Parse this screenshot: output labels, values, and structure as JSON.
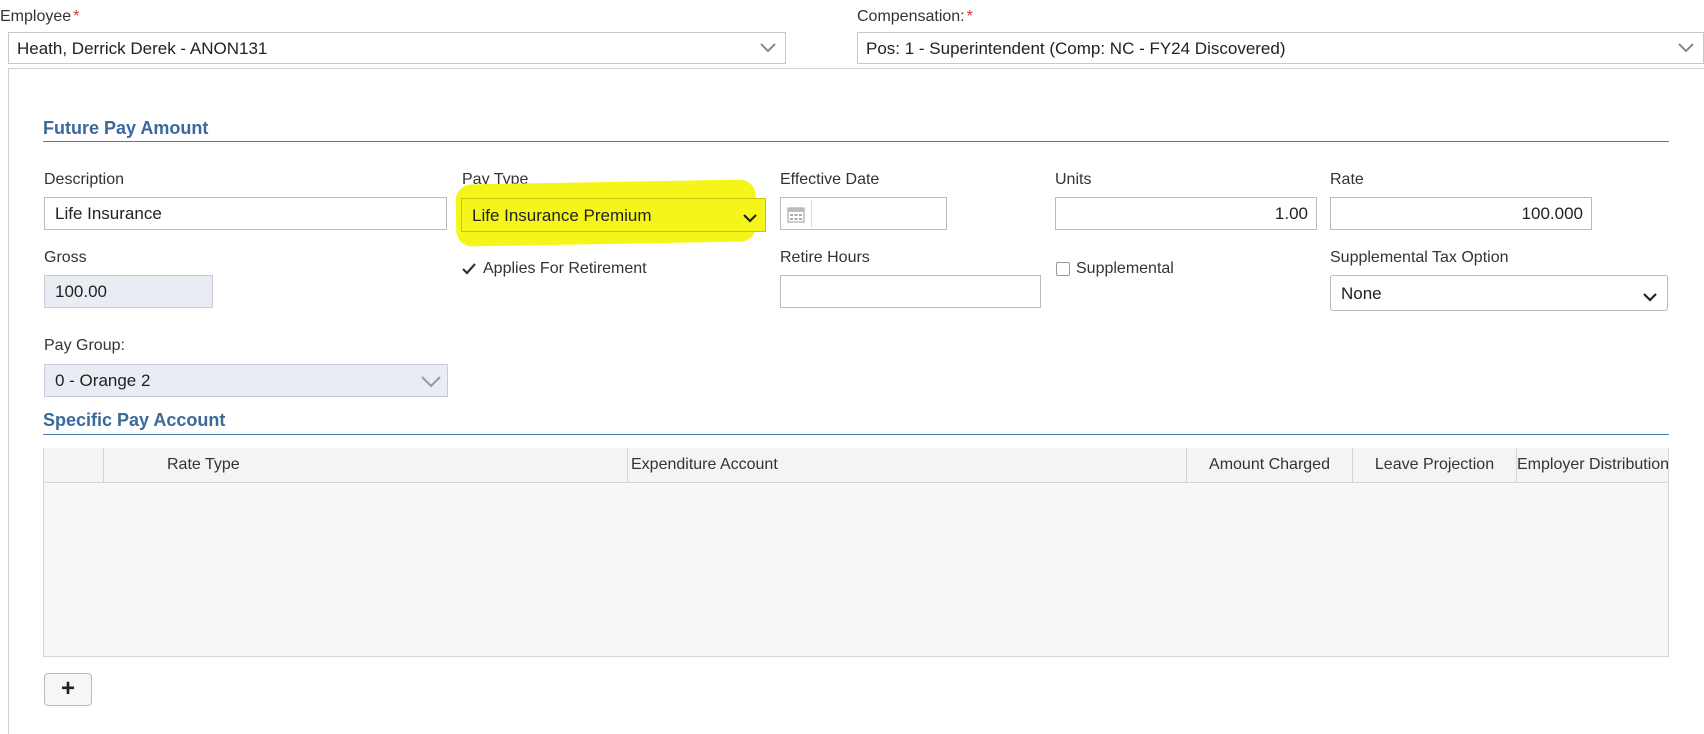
{
  "employee": {
    "label": "Employee",
    "required_mark": "*",
    "value": "Heath, Derrick Derek - ANON131"
  },
  "compensation": {
    "label": "Compensation:",
    "required_mark": "*",
    "value": "Pos: 1 - Superintendent (Comp: NC - FY24 Discovered)"
  },
  "future_pay": {
    "section_title": "Future Pay Amount",
    "description": {
      "label": "Description",
      "value": "Life Insurance"
    },
    "pay_type": {
      "label": "Pay Type",
      "value": "Life Insurance Premium",
      "highlight_color": "#f5f51a"
    },
    "effective_date": {
      "label": "Effective Date",
      "value": ""
    },
    "units": {
      "label": "Units",
      "value": "1.00"
    },
    "rate": {
      "label": "Rate",
      "value": "100.000"
    },
    "gross": {
      "label": "Gross",
      "value": "100.00"
    },
    "applies_for_retirement": {
      "label": "Applies For Retirement",
      "checked": true
    },
    "retire_hours": {
      "label": "Retire Hours",
      "value": ""
    },
    "supplemental": {
      "label": "Supplemental",
      "checked": false
    },
    "supplemental_tax_option": {
      "label": "Supplemental Tax Option",
      "value": "None"
    },
    "pay_group": {
      "label": "Pay Group:",
      "value": "0 - Orange 2"
    }
  },
  "specific_pay_account": {
    "section_title": "Specific Pay Account",
    "columns": [
      "Rate Type",
      "Expenditure Account",
      "Amount Charged",
      "Leave Projection",
      "Employer Distribution"
    ],
    "add_button": "+"
  },
  "colors": {
    "section": "#3a6a9b",
    "required": "#dd3333",
    "highlight": "#f5f51a"
  }
}
